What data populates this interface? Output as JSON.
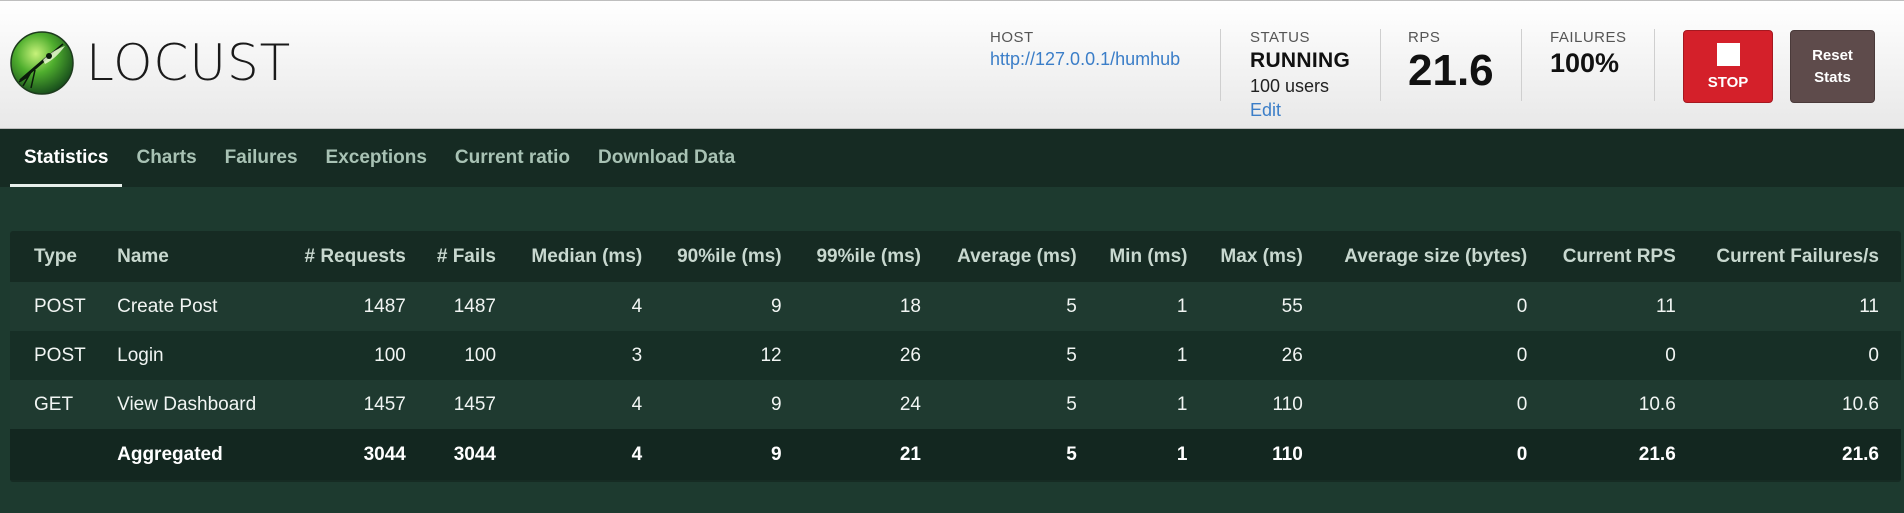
{
  "header": {
    "logo_text": "LOCUST",
    "host": {
      "label": "HOST",
      "value": "http://127.0.0.1/humhub"
    },
    "status": {
      "label": "STATUS",
      "value": "RUNNING",
      "users": "100 users",
      "edit": "Edit"
    },
    "rps": {
      "label": "RPS",
      "value": "21.6"
    },
    "failures": {
      "label": "FAILURES",
      "value": "100%"
    },
    "stop_button": {
      "label": "STOP",
      "icon": "stop-square-icon",
      "color": "#d4202a"
    },
    "reset_button": {
      "line1": "Reset",
      "line2": "Stats",
      "color": "#5e4b4b"
    }
  },
  "nav": {
    "tabs": [
      {
        "label": "Statistics",
        "active": true
      },
      {
        "label": "Charts"
      },
      {
        "label": "Failures"
      },
      {
        "label": "Exceptions"
      },
      {
        "label": "Current ratio"
      },
      {
        "label": "Download Data"
      }
    ]
  },
  "table": {
    "columns": [
      "Type",
      "Name",
      "# Requests",
      "# Fails",
      "Median (ms)",
      "90%ile (ms)",
      "99%ile (ms)",
      "Average (ms)",
      "Min (ms)",
      "Max (ms)",
      "Average size (bytes)",
      "Current RPS",
      "Current Failures/s"
    ],
    "rows": [
      [
        "POST",
        "Create Post",
        "1487",
        "1487",
        "4",
        "9",
        "18",
        "5",
        "1",
        "55",
        "0",
        "11",
        "11"
      ],
      [
        "POST",
        "Login",
        "100",
        "100",
        "3",
        "12",
        "26",
        "5",
        "1",
        "26",
        "0",
        "0",
        "0"
      ],
      [
        "GET",
        "View Dashboard",
        "1457",
        "1457",
        "4",
        "9",
        "24",
        "5",
        "1",
        "110",
        "0",
        "10.6",
        "10.6"
      ]
    ],
    "aggregated": [
      "",
      "Aggregated",
      "3044",
      "3044",
      "4",
      "9",
      "21",
      "5",
      "1",
      "110",
      "0",
      "21.6",
      "21.6"
    ]
  },
  "colors": {
    "background": "#1d3a2f",
    "nav_background": "#162b23",
    "link": "#3b7ec8"
  }
}
